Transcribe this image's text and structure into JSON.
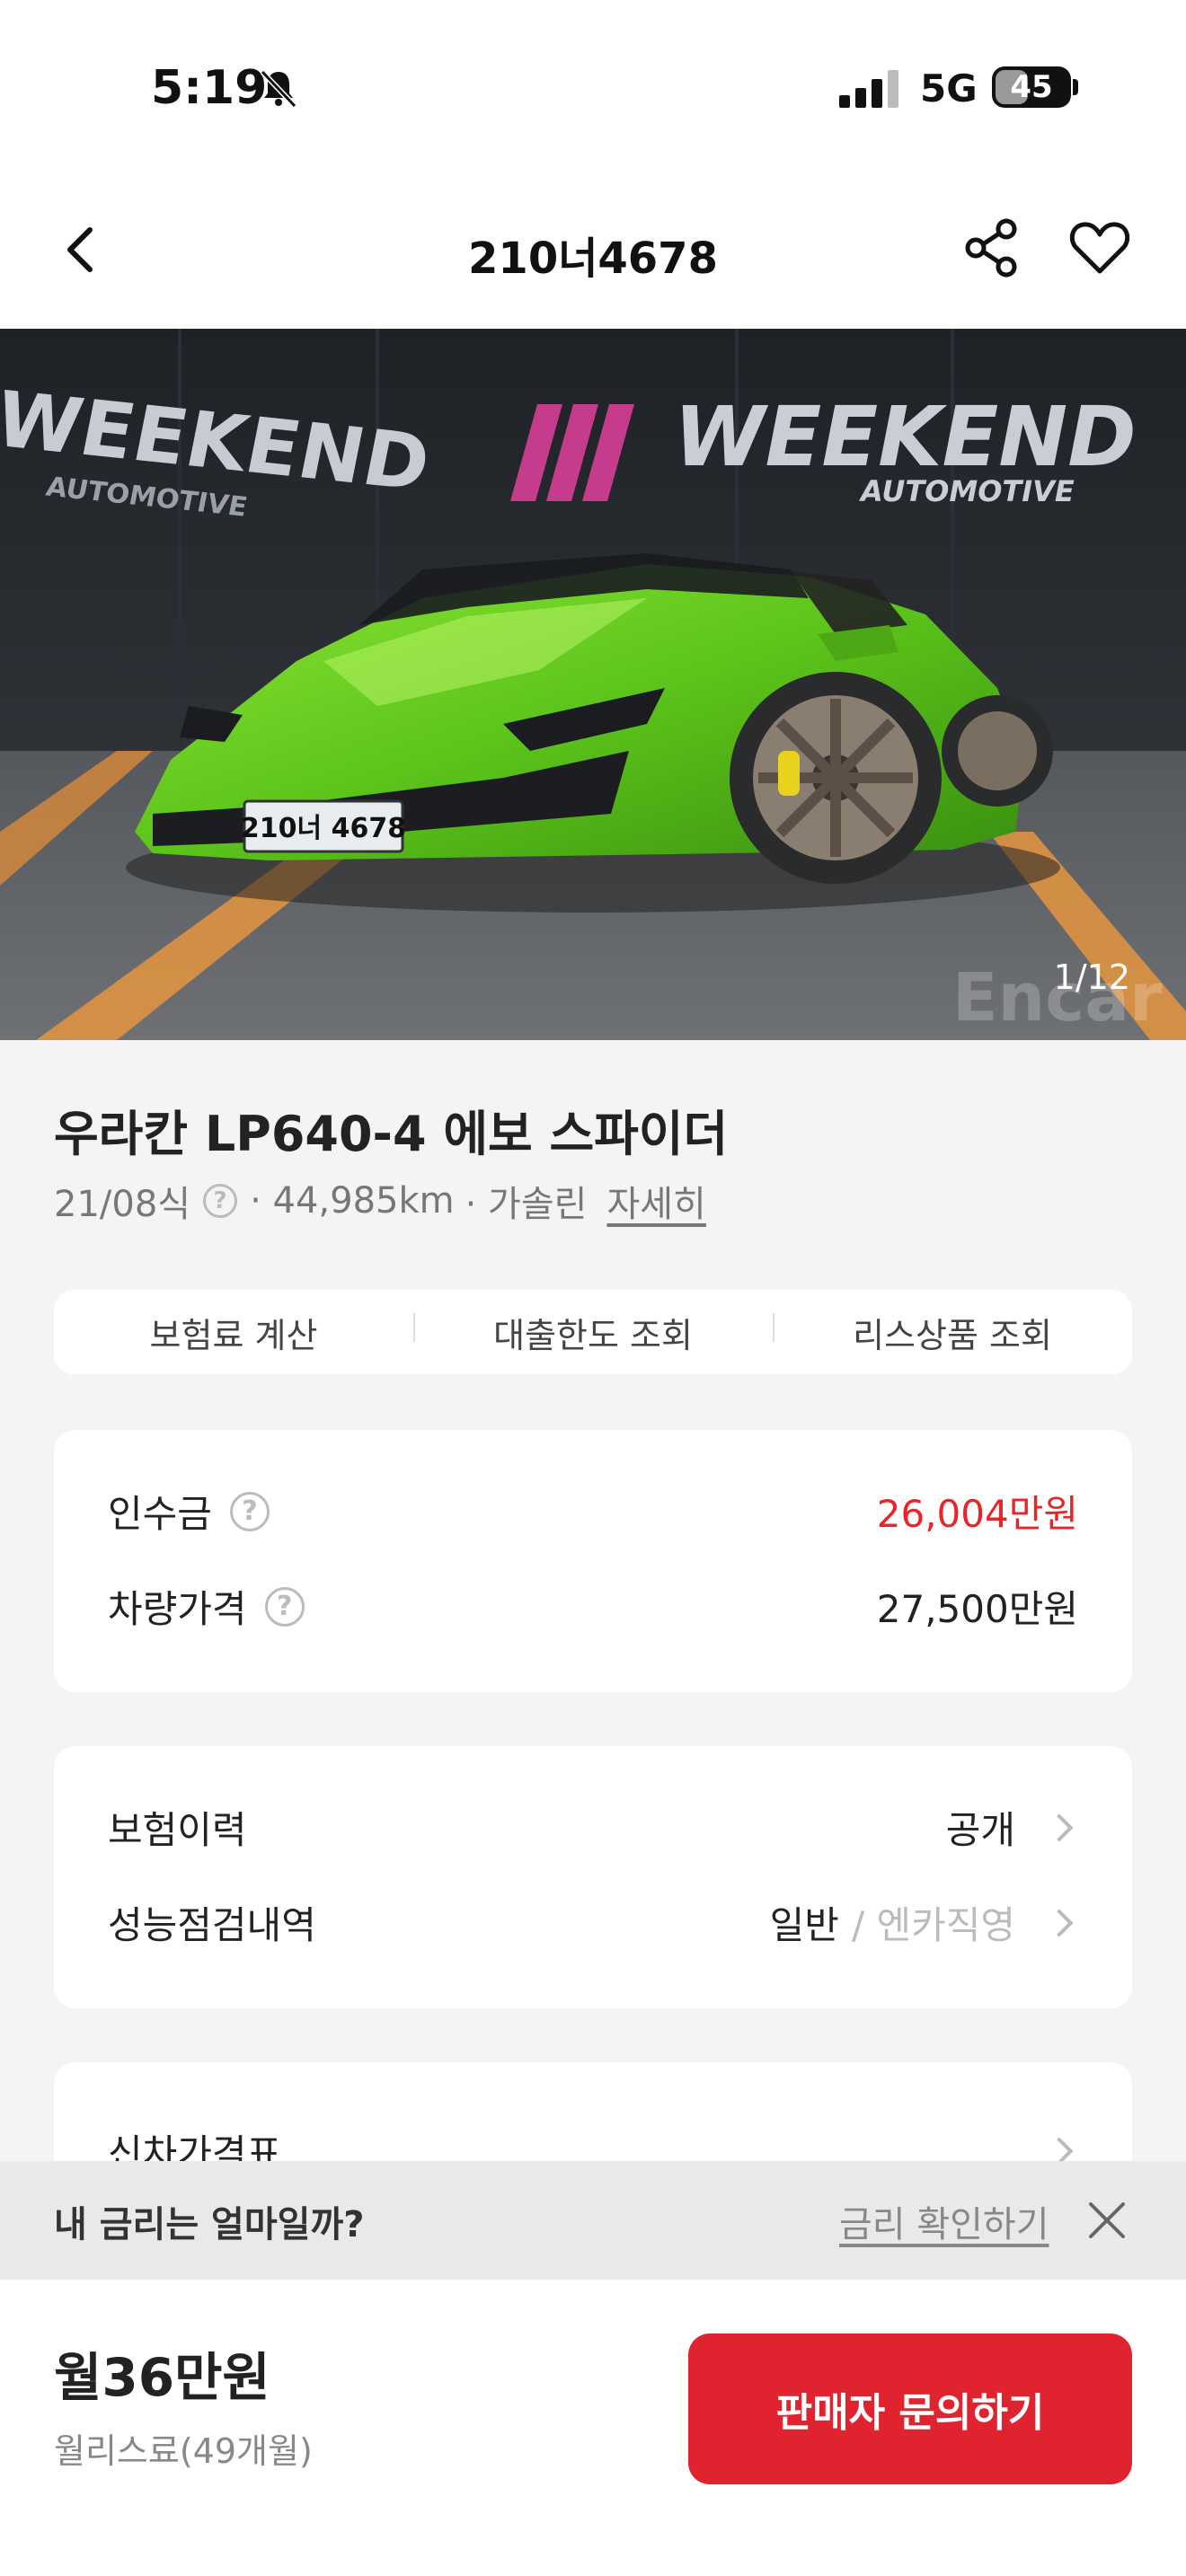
{
  "status_bar": {
    "time": "5:19",
    "network": "5G",
    "battery": "45",
    "battery_level": 0.45
  },
  "header": {
    "title": "210너4678"
  },
  "hero": {
    "banner_line1": "WEEKEND",
    "banner_line2": "AUTOMOTIVE",
    "side_sign_line1": "WEEKEND",
    "side_sign_line2": "AUTOMOTIVE",
    "plate": "210너 4678",
    "watermark": "Encar",
    "counter": "1/12",
    "car_color": "#6ccf1e"
  },
  "car": {
    "title": "우라칸 LP640-4 에보 스파이더",
    "year": "21/08식",
    "mileage": "· 44,985km",
    "fuel": "· 가솔린",
    "detail_link": "자세히"
  },
  "quick_tabs": [
    "보험료 계산",
    "대출한도 조회",
    "리스상품 조회"
  ],
  "price": {
    "takeover_label": "인수금",
    "takeover_value": "26,004만원",
    "vehicle_label": "차량가격",
    "vehicle_value": "27,500만원"
  },
  "history": {
    "insurance_label": "보험이력",
    "insurance_value": "공개",
    "inspection_label": "성능점검내역",
    "inspection_value": "일반",
    "inspection_sub": "/ 엔카직영"
  },
  "new_car": {
    "label": "신차가격표"
  },
  "rate_banner": {
    "question": "내 금리는 얼마일까?",
    "link": "금리 확인하기"
  },
  "bottom": {
    "monthly": "월36만원",
    "note": "월리스료(49개월)",
    "cta": "판매자 문의하기"
  },
  "colors": {
    "accent": "#e0242f",
    "price_red": "#e8262a"
  }
}
